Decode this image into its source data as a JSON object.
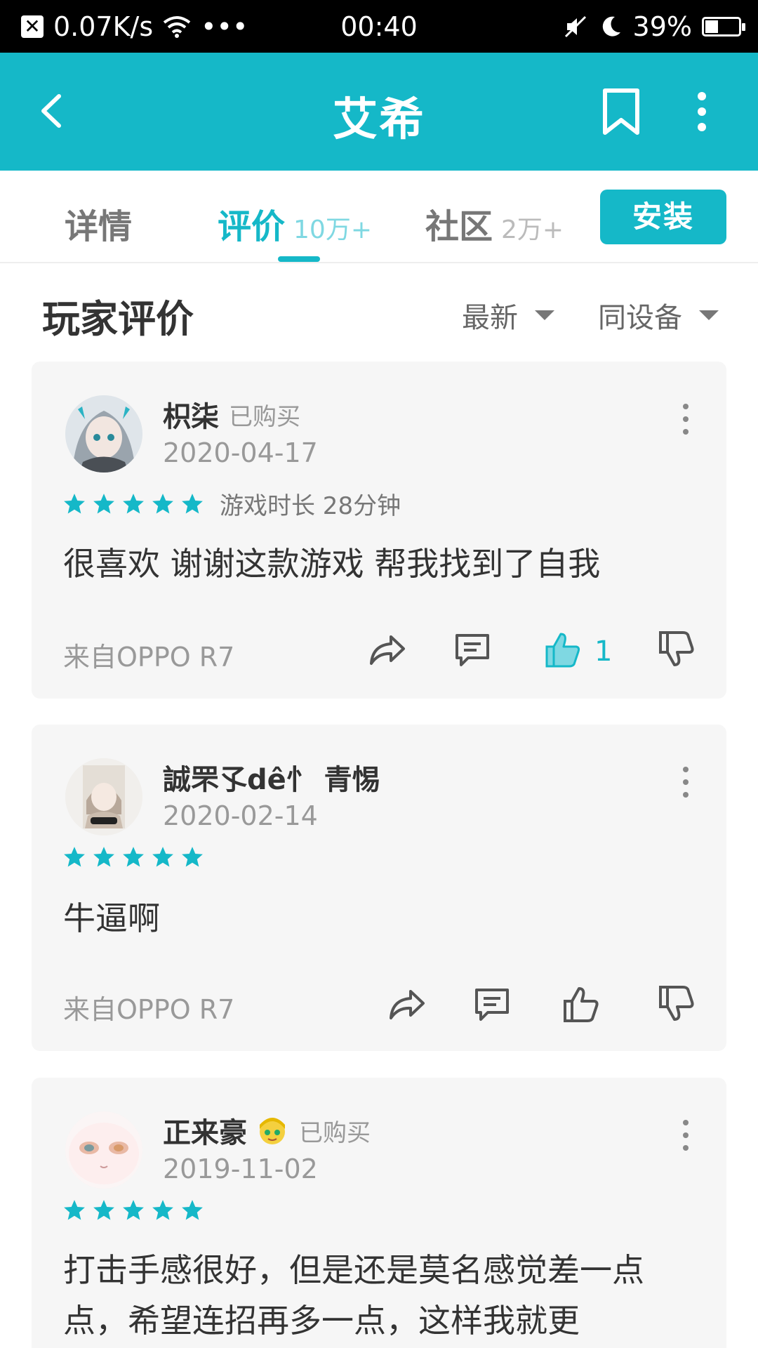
{
  "status_bar": {
    "speed": "0.07K/s",
    "dots": "•••",
    "time": "00:40",
    "battery": "39%",
    "battery_level": 0.39,
    "icons": [
      "close-badge-icon",
      "wifi-icon",
      "mute-icon",
      "moon-icon",
      "battery-icon"
    ]
  },
  "app_bar": {
    "title": "艾希",
    "icons": [
      "back-arrow-icon",
      "bookmark-icon",
      "more-vertical-icon"
    ]
  },
  "tabs": [
    {
      "label": "详情",
      "count": ""
    },
    {
      "label": "评价",
      "count": "10万+"
    },
    {
      "label": "社区",
      "count": "2万+"
    }
  ],
  "install_label": "安装",
  "section": {
    "title": "玩家评价",
    "sort_label": "最新",
    "filter_label": "同设备"
  },
  "reviews": [
    {
      "username": "枳柒",
      "purchase_badge": "已购买",
      "date": "2020-04-17",
      "rating": 5,
      "playtime": "游戏时长 28分钟",
      "text": "很喜欢 谢谢这款游戏 帮我找到了自我",
      "device": "来自OPPO R7",
      "likes": "1",
      "liked": true
    },
    {
      "username": "誠罘孓dê忄 青惕",
      "purchase_badge": "",
      "date": "2020-02-14",
      "rating": 5,
      "playtime": "",
      "text": "牛逼啊",
      "device": "来自OPPO R7",
      "likes": "",
      "liked": false
    },
    {
      "username": "正来豪",
      "purchase_badge": "已购买",
      "date": "2019-11-02",
      "rating": 5,
      "playtime": "",
      "text": "打击手感很好，但是还是莫名感觉差一点点，希望连招再多一点，这样我就更",
      "device": "",
      "likes": "",
      "liked": false
    }
  ],
  "colors": {
    "accent": "#15b8c8",
    "card_bg": "#f6f6f6",
    "status_bar": "#000000"
  }
}
